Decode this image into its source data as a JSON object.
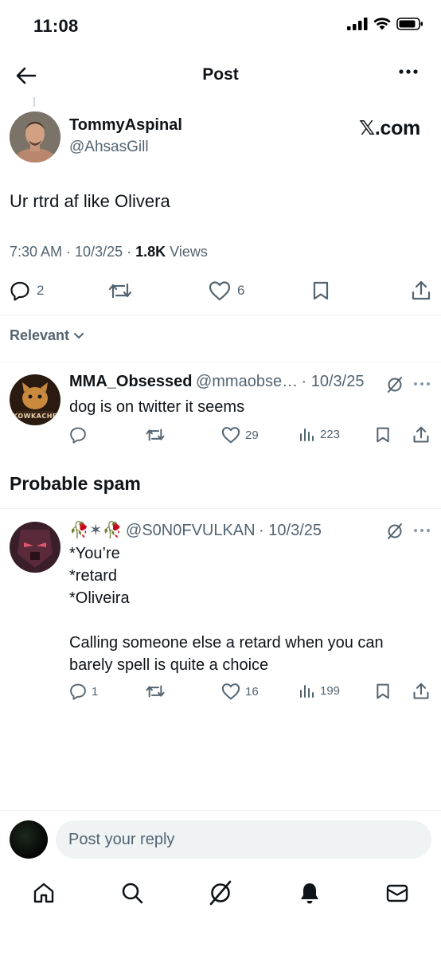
{
  "status_bar": {
    "time": "11:08"
  },
  "header": {
    "title": "Post"
  },
  "post": {
    "display_name": "TommyAspinal",
    "handle": "@AhsasGill",
    "source_logo": "𝕏.com",
    "text": "Ur rtrd af like Olivera",
    "time": "7:30 AM",
    "date": "10/3/25",
    "views_count": "1.8K",
    "views_label": "Views",
    "replies": "2",
    "likes": "6"
  },
  "sort": {
    "label": "Relevant"
  },
  "replies": [
    {
      "display_name": "MMA_Obsessed",
      "handle": "@mmaobse…",
      "date": "· 10/3/25",
      "text": "dog is on twitter it seems",
      "replies": "",
      "retweets": "",
      "likes": "29",
      "views": "223",
      "avatar_caption": "KOWKACHE"
    }
  ],
  "spam_section": {
    "heading": "Probable spam",
    "reply": {
      "display_name": "🥀✶🥀",
      "handle": "@S0N0FVULKAN",
      "date": "· 10/3/25",
      "lines": [
        "*You’re",
        "*retard",
        "*Oliveira",
        "",
        "Calling someone else a retard when you can",
        "barely spell is quite a choice"
      ],
      "replies": "1",
      "likes": "16",
      "views": "199"
    }
  },
  "reply_bar": {
    "placeholder": "Post your reply"
  },
  "colors": {
    "text": "#0f1419",
    "secondary": "#536471",
    "divider": "#eff3f4"
  }
}
